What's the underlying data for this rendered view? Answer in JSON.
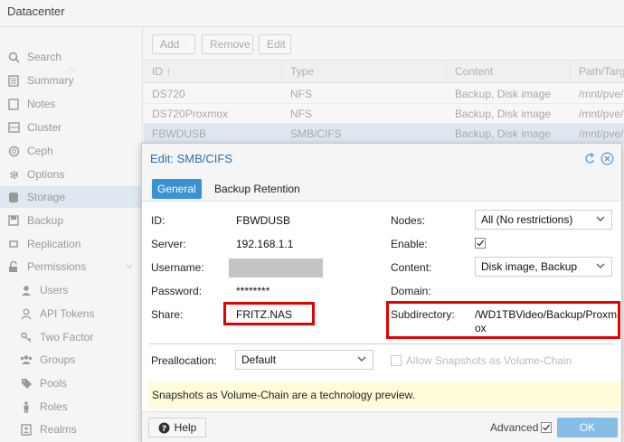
{
  "header": {
    "title": "Datacenter"
  },
  "sidebar": {
    "items": [
      {
        "label": "Search",
        "icon": "search-icon"
      },
      {
        "label": "Summary",
        "icon": "summary-icon"
      },
      {
        "label": "Notes",
        "icon": "notes-icon"
      },
      {
        "label": "Cluster",
        "icon": "server-icon"
      },
      {
        "label": "Ceph",
        "icon": "ceph-icon"
      },
      {
        "label": "Options",
        "icon": "gear-icon"
      },
      {
        "label": "Storage",
        "icon": "database-icon"
      },
      {
        "label": "Backup",
        "icon": "floppy-icon"
      },
      {
        "label": "Replication",
        "icon": "retweet-icon"
      },
      {
        "label": "Permissions",
        "icon": "unlock-icon"
      },
      {
        "label": "Users",
        "icon": "user-icon"
      },
      {
        "label": "API Tokens",
        "icon": "user-o-icon"
      },
      {
        "label": "Two Factor",
        "icon": "key-icon"
      },
      {
        "label": "Groups",
        "icon": "users-icon"
      },
      {
        "label": "Pools",
        "icon": "tags-icon"
      },
      {
        "label": "Roles",
        "icon": "male-icon"
      },
      {
        "label": "Realms",
        "icon": "address-book-icon"
      }
    ]
  },
  "toolbar": {
    "add_label": "Add",
    "remove_label": "Remove",
    "edit_label": "Edit"
  },
  "grid": {
    "headers": {
      "id": "ID ↑",
      "type": "Type",
      "content": "Content",
      "path": "Path/Targ"
    },
    "rows": [
      {
        "id": "DS720",
        "type": "NFS",
        "content": "Backup, Disk image",
        "path": "/mnt/pve/I"
      },
      {
        "id": "DS720Proxmox",
        "type": "NFS",
        "content": "Backup, Disk image",
        "path": "/mnt/pve/I"
      },
      {
        "id": "FBWDUSB",
        "type": "SMB/CIFS",
        "content": "Backup, Disk image",
        "path": "/mnt/pve/I"
      }
    ]
  },
  "dialog": {
    "title": "Edit: SMB/CIFS",
    "tabs": {
      "general": "General",
      "backup_retention": "Backup Retention"
    },
    "labels": {
      "id": "ID:",
      "server": "Server:",
      "username": "Username:",
      "password": "Password:",
      "share": "Share:",
      "nodes": "Nodes:",
      "enable": "Enable:",
      "content": "Content:",
      "domain": "Domain:",
      "subdirectory": "Subdirectory:",
      "preallocation": "Preallocation:",
      "allow_snapshots": "Allow Snapshots as Volume-Chain"
    },
    "values": {
      "id": "FBWDUSB",
      "server": "192.168.1.1",
      "password": "********",
      "share": "FRITZ.NAS",
      "nodes": "All (No restrictions)",
      "content": "Disk image, Backup",
      "subdirectory_line1": "/WD1TBVideo/Backup/Proxm",
      "subdirectory_line2": "ox",
      "preallocation": "Default"
    },
    "notice": "Snapshots as Volume-Chain are a technology preview.",
    "help_label": "Help",
    "advanced_label": "Advanced",
    "ok_label": "OK"
  },
  "colors": {
    "accent": "#3892d4",
    "title": "#2b6fb0",
    "highlight_box": "#e60000",
    "ok_button": "#86bde7",
    "notice_bg": "#fffcdb"
  }
}
